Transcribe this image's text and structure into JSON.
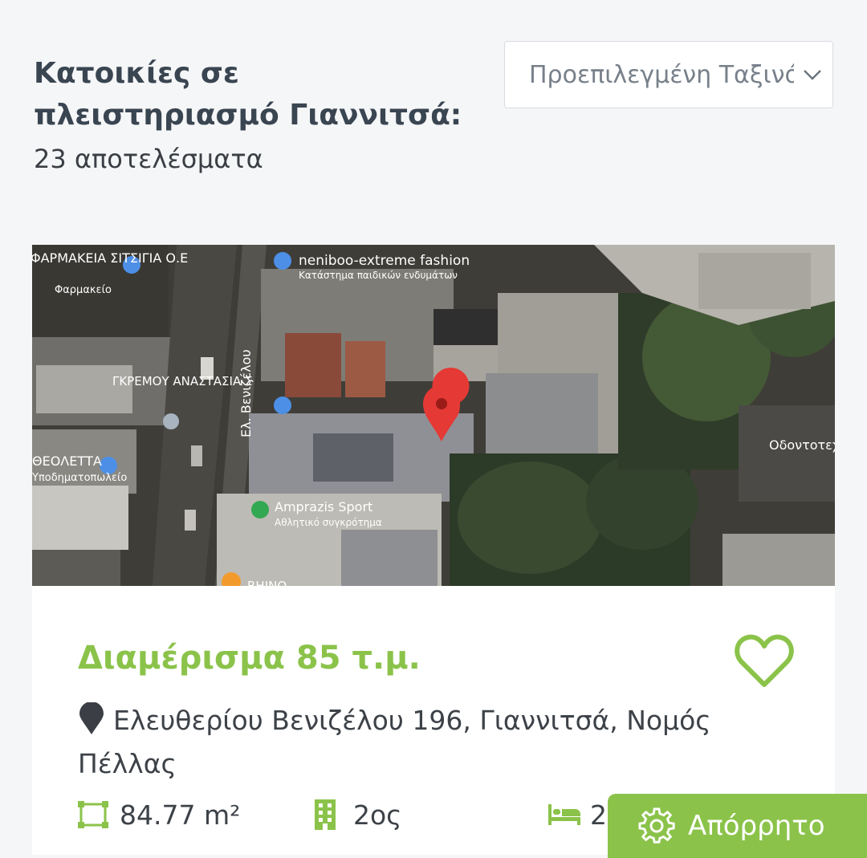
{
  "page": {
    "heading_title": "Κατοικίες σε πλειστηριασμό Γιαννιτσά:",
    "results_count": "23 αποτελέσματα"
  },
  "sort": {
    "selected": "Προεπιλεγμένη Ταξινόμηση"
  },
  "map": {
    "labels": {
      "pharmacy_name": "ΦΑΡΜΑΚΕΙΑ ΣΙΤΣΙΓΙΑ Ο.Ε",
      "pharmacy_type": "Φαρμακείο",
      "shop_name": "neniboo-extreme fashion",
      "shop_type": "Κατάστημα παιδικών ενδυμάτων",
      "street": "Ελ. Βενιζέλου",
      "person_place": "ΓΚΡΕΜΟΥ ΑΝΑΣΤΑΣΙΑ Σ",
      "shoe_shop": "ΘΕΟΛΕΤΤΑ",
      "shoe_shop_type": "Υποδηματοπωλείο",
      "sport_name": "Amprazis Sport",
      "sport_type": "Αθλητικό συγκρότημα",
      "dental": "Οδοντοτεχνικό Εργαστήριο",
      "rhino": "RHINO"
    }
  },
  "listing": {
    "title": "Διαμέρισμα 85 τ.μ.",
    "address": "Ελευθερίου Βενιζέλου 196, Γιαννιτσά, Νομός Πέλλας",
    "area": "84.77 m²",
    "floor": "2ος",
    "bedrooms": "2"
  },
  "privacy_button": {
    "label": "Απόρρητο"
  },
  "colors": {
    "accent_green": "#8bc34a",
    "map_pin_red": "#e53935",
    "heading_text": "#3a4552"
  },
  "icons": [
    "chevron-down-icon",
    "heart-icon",
    "location-pin-icon",
    "area-icon",
    "building-icon",
    "bed-icon",
    "gear-icon"
  ]
}
